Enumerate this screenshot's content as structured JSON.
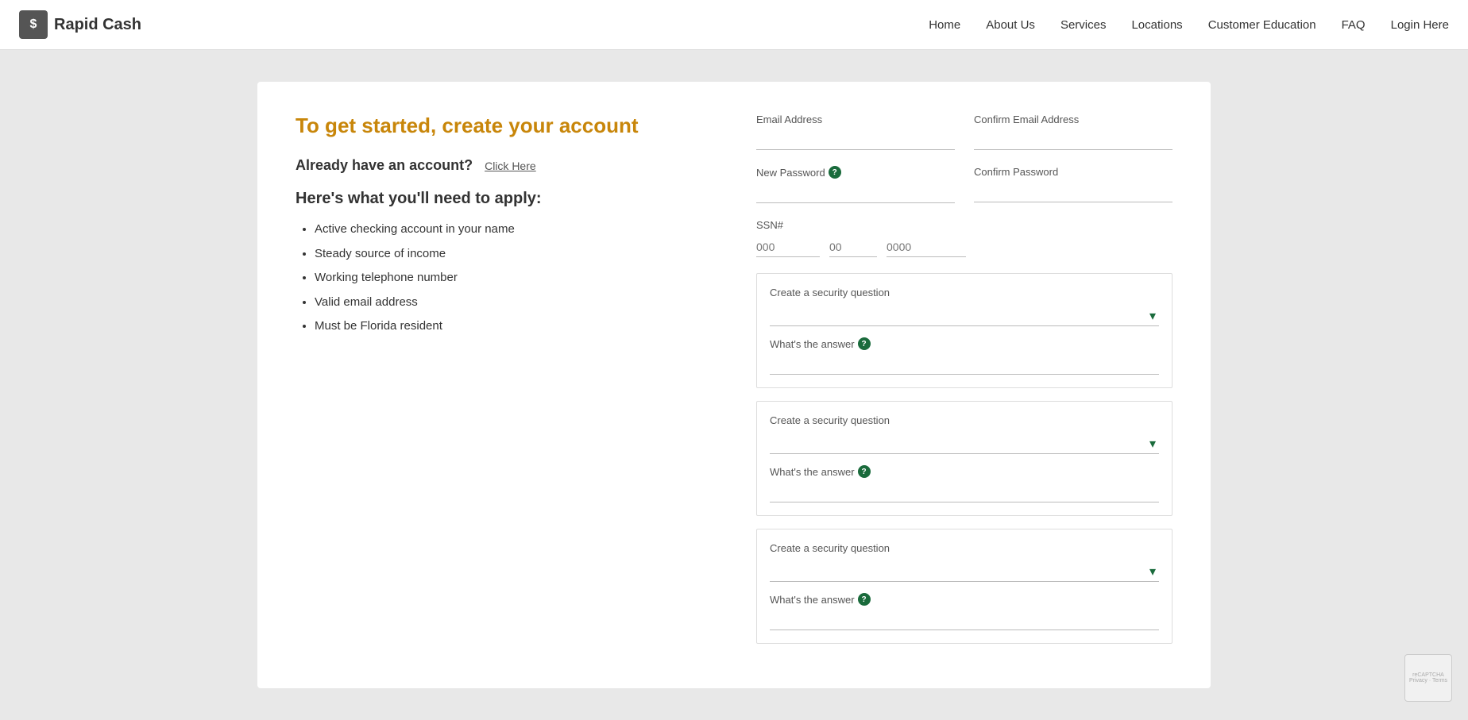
{
  "header": {
    "logo_text": "Rapid Cash",
    "logo_icon": "$",
    "nav": {
      "home": "Home",
      "about_us": "About Us",
      "services": "Services",
      "locations": "Locations",
      "customer_education": "Customer Education",
      "faq": "FAQ",
      "login": "Login Here"
    }
  },
  "page": {
    "title": "To get started, create your account",
    "have_account_label": "Already have an account?",
    "have_account_link": "Click Here",
    "need_label": "Here's what you'll need to apply:",
    "requirements": [
      "Active checking account in your name",
      "Steady source of income",
      "Working telephone number",
      "Valid email address",
      "Must be Florida resident"
    ]
  },
  "form": {
    "email_label": "Email Address",
    "email_placeholder": "",
    "confirm_email_label": "Confirm Email Address",
    "confirm_email_placeholder": "",
    "new_password_label": "New Password",
    "confirm_password_label": "Confirm Password",
    "ssn_label": "SSN#",
    "ssn_part1_placeholder": "000",
    "ssn_part2_placeholder": "00",
    "ssn_part3_placeholder": "0000",
    "security_question_label": "Create a security question",
    "answer_label": "What's the answer",
    "help_icon_text": "?",
    "chevron": "▾",
    "security_questions": [
      {
        "question_label": "Create a security question",
        "answer_label": "What's the answer"
      },
      {
        "question_label": "Create a security question",
        "answer_label": "What's the answer"
      },
      {
        "question_label": "Create a security question",
        "answer_label": "What's the answer"
      }
    ]
  }
}
